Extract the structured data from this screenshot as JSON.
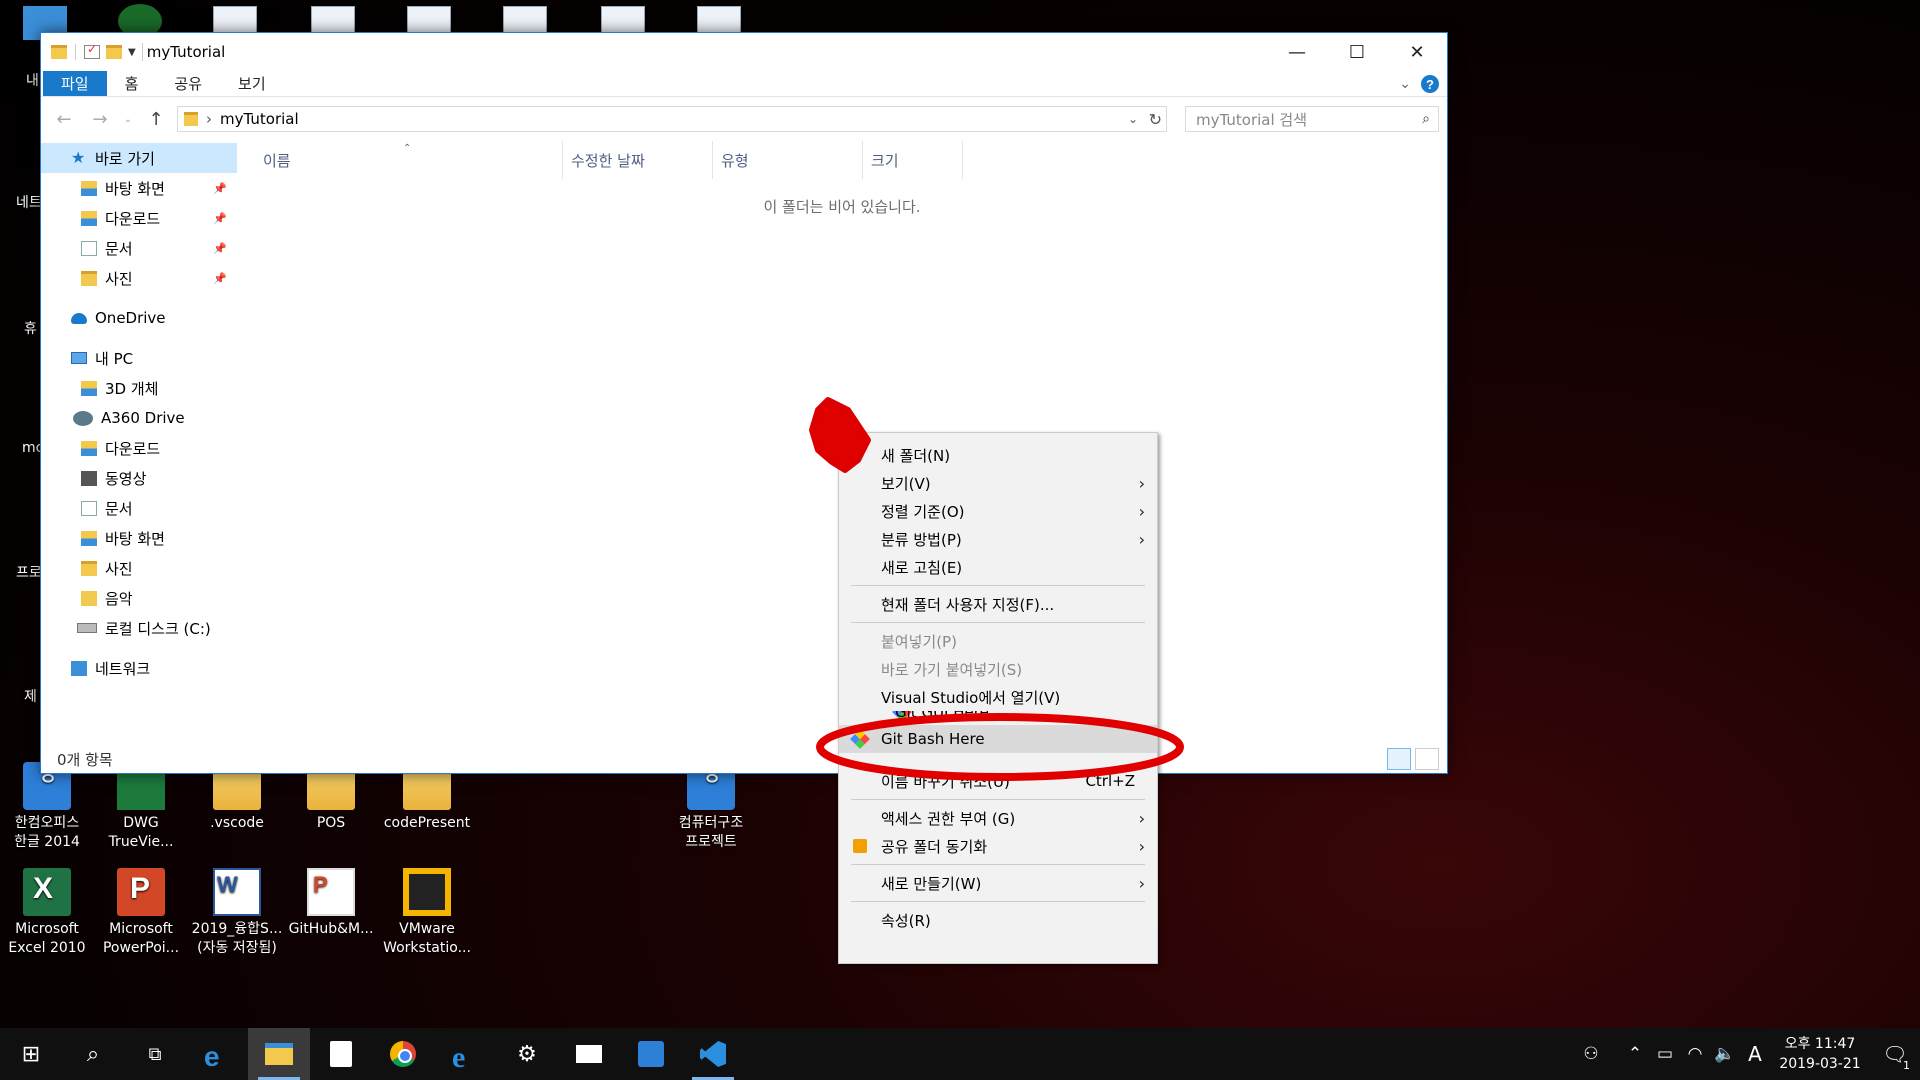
{
  "window": {
    "title": "myTutorial",
    "controls": {
      "minimize": "—",
      "maximize": "☐",
      "close": "✕"
    }
  },
  "ribbon": {
    "tabs": [
      "파일",
      "홈",
      "공유",
      "보기"
    ],
    "help": "?"
  },
  "address": {
    "path": "myTutorial",
    "search_placeholder": "myTutorial 검색"
  },
  "nav": {
    "quick_access": "바로 가기",
    "quick_items": [
      "바탕 화면",
      "다운로드",
      "문서",
      "사진"
    ],
    "onedrive": "OneDrive",
    "this_pc": "내 PC",
    "pc_items": [
      "3D 개체",
      "A360 Drive",
      "다운로드",
      "동영상",
      "문서",
      "바탕 화면",
      "사진",
      "음악",
      "로컬 디스크 (C:)"
    ],
    "network": "네트워크"
  },
  "columns": [
    "이름",
    "수정한 날짜",
    "유형",
    "크기"
  ],
  "empty_message": "이 폴더는 비어 있습니다.",
  "status": "0개 항목",
  "context_menu": {
    "items": [
      {
        "label": "새 폴더(N)"
      },
      {
        "label": "보기(V)",
        "submenu": true
      },
      {
        "label": "정렬 기준(O)",
        "submenu": true
      },
      {
        "label": "분류 방법(P)",
        "submenu": true
      },
      {
        "label": "새로 고침(E)"
      },
      {
        "label": "현재 폴더 사용자 지정(F)..."
      },
      {
        "label": "붙여넣기(P)",
        "disabled": true
      },
      {
        "label": "바로 가기 붙여넣기(S)",
        "disabled": true
      },
      {
        "label": "Visual Studio에서 열기(V)"
      },
      {
        "label": "Git GUI Here"
      },
      {
        "label": "Git Bash Here"
      },
      {
        "label": "이름 바꾸기 취소(U)",
        "shortcut": "Ctrl+Z"
      },
      {
        "label": "액세스 권한 부여 (G)",
        "submenu": true
      },
      {
        "label": "공유 폴더 동기화",
        "submenu": true
      },
      {
        "label": "새로 만들기(W)",
        "submenu": true
      },
      {
        "label": "속성(R)"
      }
    ]
  },
  "desktop": {
    "edge_labels": [
      "내",
      "네트",
      "휴",
      "mc",
      "프로",
      "제"
    ],
    "icons_row1": [
      "한컴오피스\n한글 2014",
      "DWG\nTrueVie...",
      ".vscode",
      "POS",
      "codePresent",
      "컴퓨터구조\n프로젝트"
    ],
    "icons_row2": [
      "Microsoft\nExcel 2010",
      "Microsoft\nPowerPoi...",
      "2019_융합S...\n(자동 저장됨)",
      "GitHub&M...",
      "VMware\nWorkstatio..."
    ]
  },
  "taskbar": {
    "clock_period": "오후 11:47",
    "date": "2019-03-21",
    "ime": "A",
    "notifications": "1"
  },
  "colors": {
    "accent": "#1979ca",
    "annotation": "#e00000",
    "menu_bg": "#f2f2f2"
  }
}
